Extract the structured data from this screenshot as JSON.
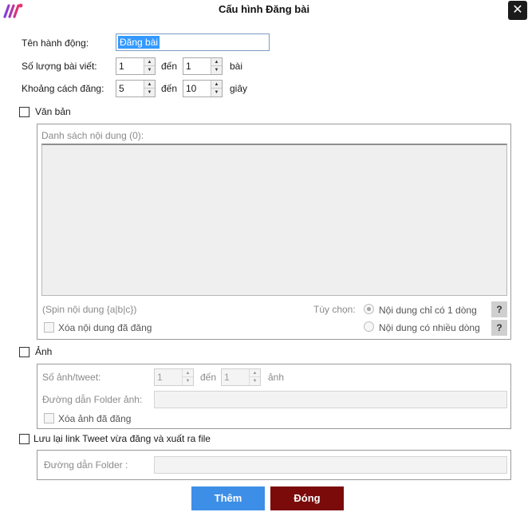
{
  "window": {
    "title": "Cấu hình Đăng bài",
    "close_glyph": "✕",
    "logo_icon": "app-logo-icon",
    "colors": {
      "logo_start": "#7b3fe4",
      "logo_end": "#e8326a",
      "selection": "#3399ff"
    }
  },
  "settings": {
    "action_name_label": "Tên hành động:",
    "action_name_value": "Đăng bài",
    "post_count_label": "Số lượng bài viết:",
    "post_count_from": "1",
    "post_count_to_label": "đến",
    "post_count_to": "1",
    "post_count_unit": "bài",
    "interval_label": "Khoảng cách đăng:",
    "interval_from": "5",
    "interval_to_label": "đến",
    "interval_to": "10",
    "interval_unit": "giây"
  },
  "text_section": {
    "checkbox_label": "Văn bản",
    "list_label": "Danh sách nội dung (0):",
    "spin_hint": "(Spin nội dung {a|b|c})",
    "options_label": "Tùy chọn:",
    "option_single_line": "Nội dung chỉ có 1 dòng",
    "option_multi_line": "Nội dung có nhiều dòng",
    "delete_posted_label": "Xóa nội dung đã đăng",
    "help_glyph": "?"
  },
  "image_section": {
    "checkbox_label": "Ảnh",
    "images_per_tweet_label": "Số ảnh/tweet:",
    "images_from": "1",
    "images_to_label": "đến",
    "images_to": "1",
    "images_unit": "ảnh",
    "folder_label": "Đường dẫn Folder ảnh:",
    "folder_value": "",
    "delete_posted_label": "Xóa ảnh đã đăng"
  },
  "export_section": {
    "checkbox_label": "Lưu lại link Tweet vừa đăng và xuất ra file",
    "folder_label": "Đường dẫn Folder :",
    "folder_value": ""
  },
  "buttons": {
    "add_label": "Thêm",
    "close_label": "Đóng",
    "add_color": "#3d8ee6",
    "close_color": "#7b0a0a"
  }
}
